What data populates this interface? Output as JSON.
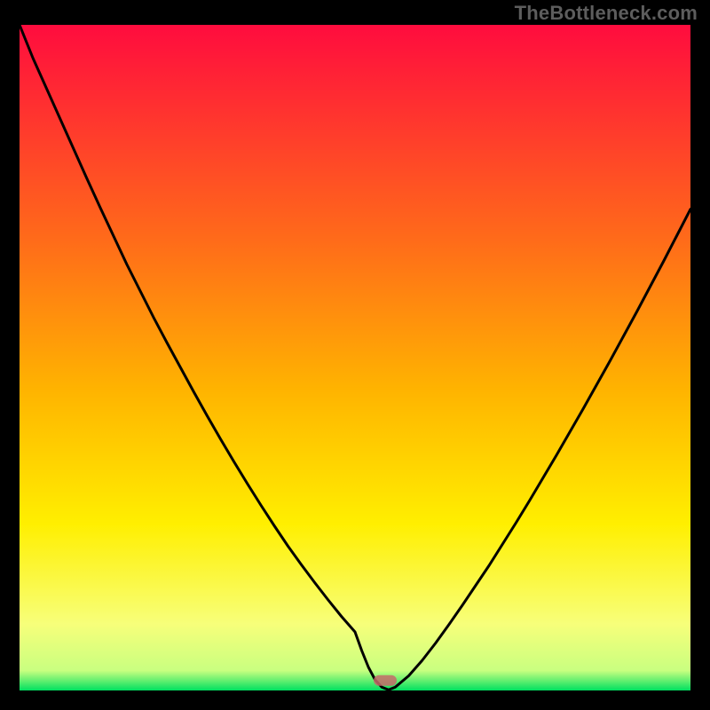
{
  "attribution": "TheBottleneck.com",
  "chart_data": {
    "type": "line",
    "title": "",
    "xlabel": "",
    "ylabel": "",
    "xlim": [
      0,
      100
    ],
    "ylim": [
      0,
      100
    ],
    "x": [
      0,
      2,
      4,
      6,
      8,
      10,
      12,
      14,
      16,
      18,
      20,
      22,
      24,
      26,
      28,
      30,
      32,
      34,
      36,
      38,
      40,
      42,
      44,
      46,
      48,
      50,
      51,
      52,
      53,
      54,
      55,
      56,
      58,
      60,
      62,
      64,
      66,
      68,
      70,
      72,
      74,
      76,
      78,
      80,
      82,
      84,
      86,
      88,
      90,
      92,
      94,
      96,
      98,
      100
    ],
    "values": [
      100,
      95,
      90.5,
      86,
      81.5,
      77,
      72.6,
      68.3,
      64,
      60,
      56,
      52.2,
      48.5,
      44.8,
      41.2,
      37.7,
      34.3,
      31,
      27.8,
      24.7,
      21.7,
      18.9,
      16.2,
      13.6,
      11.1,
      8.8,
      6,
      3.5,
      1.6,
      0.5,
      0.1,
      0.5,
      2.2,
      4.5,
      7.1,
      9.9,
      12.8,
      15.8,
      18.8,
      22,
      25.2,
      28.5,
      31.9,
      35.3,
      38.8,
      42.3,
      45.9,
      49.5,
      53.2,
      56.9,
      60.7,
      64.5,
      68.4,
      72.3
    ],
    "minimum_point": {
      "x": 54.5,
      "y": 0
    },
    "marker": {
      "x": 54.5,
      "y": 1.5,
      "color": "#c56a6a"
    },
    "background_gradient": {
      "top": "#ff0c3e",
      "mid_upper": "#ffb400",
      "mid": "#ffef00",
      "lower": "#f7ff7a",
      "bottom": "#00e060"
    }
  }
}
